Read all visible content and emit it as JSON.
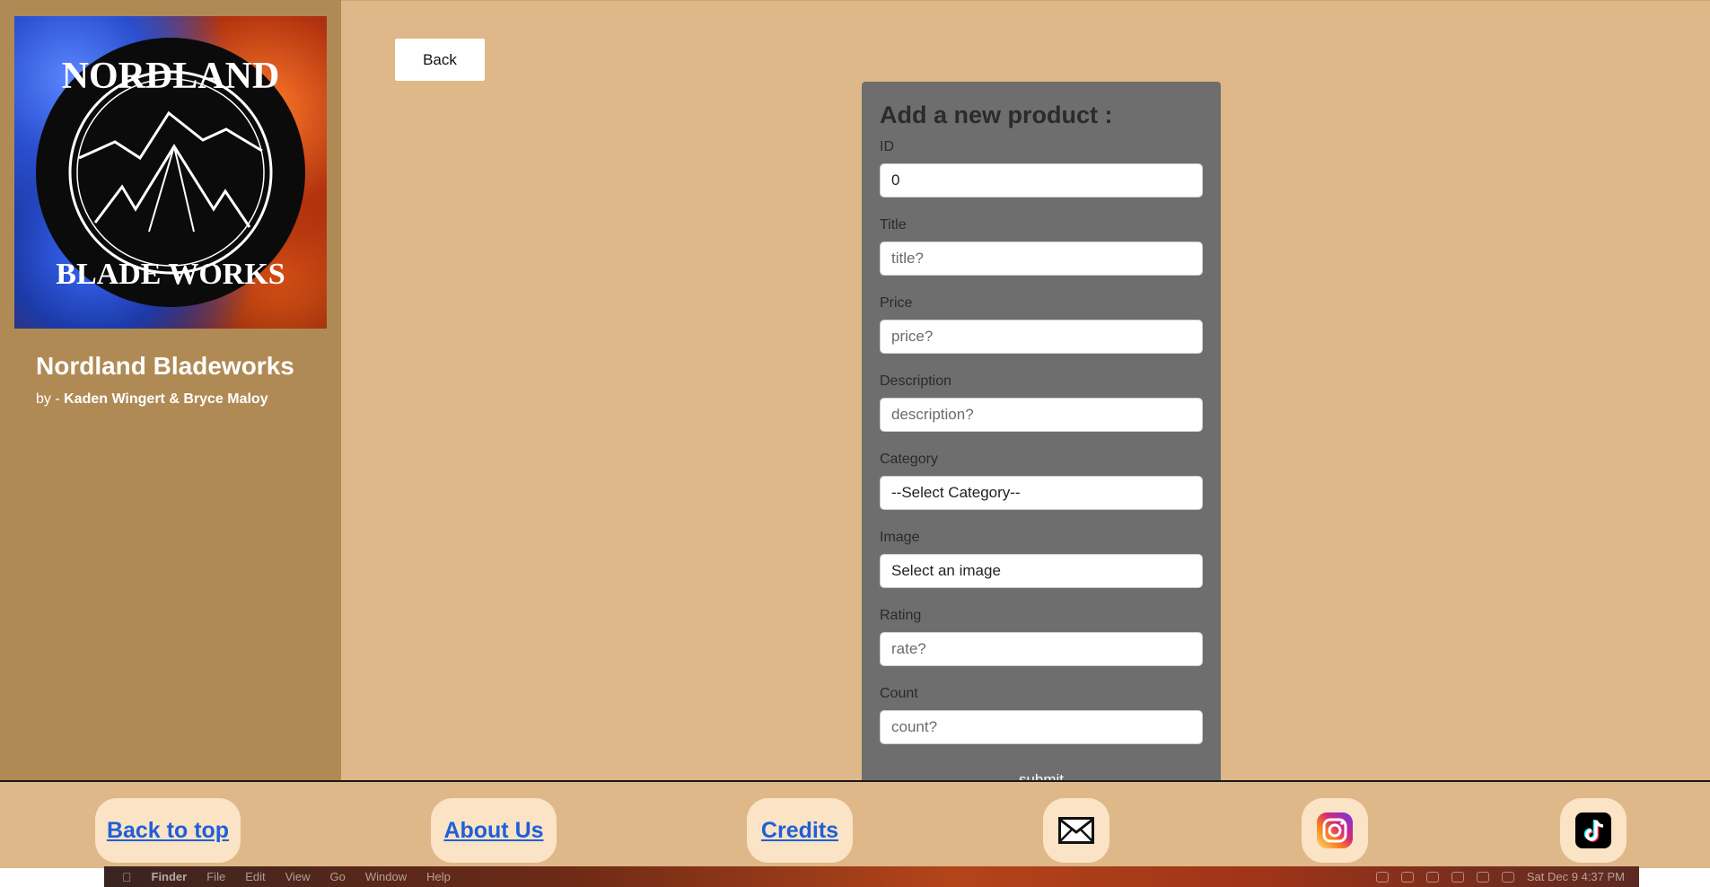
{
  "brand": {
    "logo_icon": "nordland-bladeworks-logo",
    "logo_text_top": "NORDLAND",
    "logo_text_bottom": "BLADE WORKS",
    "title": "Nordland Bladeworks",
    "by_prefix": "by -",
    "authors": "Kaden Wingert & Bryce Maloy"
  },
  "toolbar": {
    "back_label": "Back"
  },
  "form": {
    "heading": "Add a new product :",
    "fields": [
      {
        "label": "ID",
        "value": "0",
        "placeholder": ""
      },
      {
        "label": "Title",
        "value": "",
        "placeholder": "title?"
      },
      {
        "label": "Price",
        "value": "",
        "placeholder": "price?"
      },
      {
        "label": "Description",
        "value": "",
        "placeholder": "description?"
      },
      {
        "label": "Category",
        "selected": "--Select Category--"
      },
      {
        "label": "Image",
        "selected": "Select an image"
      },
      {
        "label": "Rating",
        "value": "",
        "placeholder": "rate?"
      },
      {
        "label": "Count",
        "value": "",
        "placeholder": "count?"
      }
    ],
    "submit_label": "submit"
  },
  "footer": {
    "links": [
      "Back to top",
      "About Us",
      "Credits"
    ],
    "icons": [
      "mail-icon",
      "instagram-icon",
      "tiktok-icon"
    ]
  },
  "menubar": {
    "app": "Finder",
    "items": [
      "File",
      "Edit",
      "View",
      "Go",
      "Window",
      "Help"
    ],
    "clock": "Sat Dec 9  4:37 PM"
  },
  "colors": {
    "sidebar_bg": "#b08a55",
    "main_bg": "#deb888",
    "form_bg": "#6e6e6e",
    "pill_bg": "#fbe3c6",
    "link": "#1f5fd8"
  }
}
